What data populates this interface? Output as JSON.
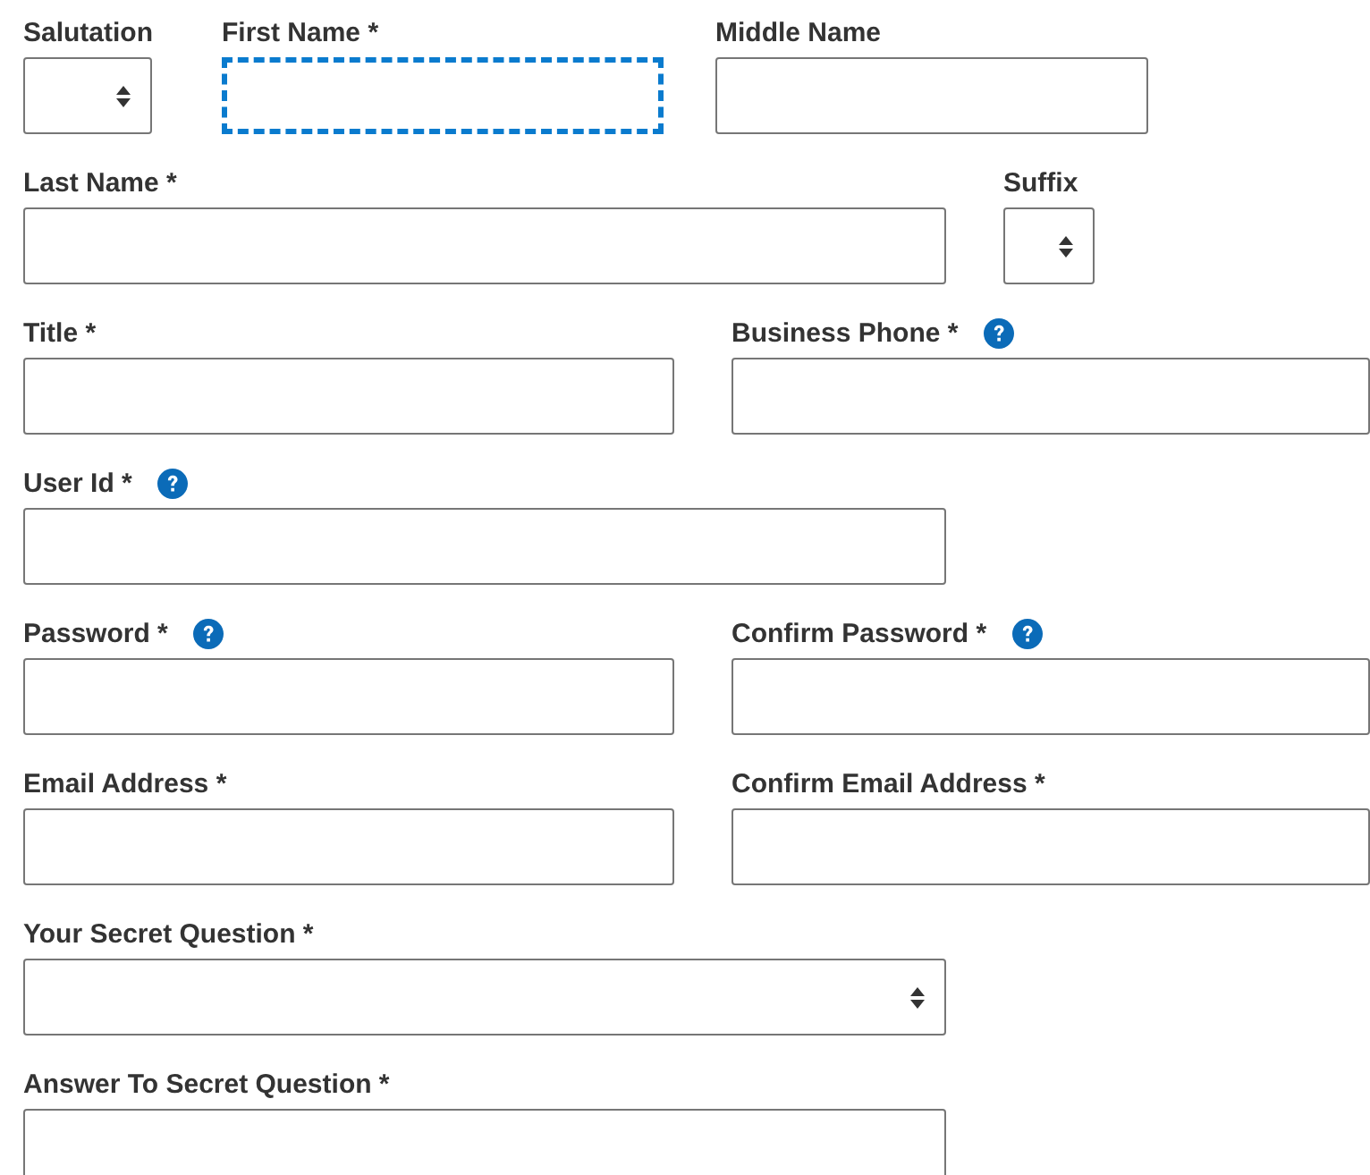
{
  "rows": [
    {
      "fields": [
        {
          "label": "Salutation",
          "kind": "select",
          "help": false,
          "focused": false
        },
        {
          "label": "First Name *",
          "kind": "text",
          "help": false,
          "focused": true
        },
        {
          "label": "Middle Name",
          "kind": "text",
          "help": false,
          "focused": false
        }
      ]
    },
    {
      "fields": [
        {
          "label": "Last Name *",
          "kind": "text",
          "help": false,
          "focused": false
        },
        {
          "label": "Suffix",
          "kind": "select",
          "help": false,
          "focused": false
        }
      ]
    },
    {
      "fields": [
        {
          "label": "Title *",
          "kind": "text",
          "help": false,
          "focused": false
        },
        {
          "label": "Business Phone *",
          "kind": "text",
          "help": true,
          "focused": false
        }
      ]
    },
    {
      "fields": [
        {
          "label": "User Id *",
          "kind": "text",
          "help": true,
          "focused": false
        }
      ]
    },
    {
      "fields": [
        {
          "label": "Password *",
          "kind": "text",
          "help": true,
          "focused": false
        },
        {
          "label": "Confirm Password *",
          "kind": "text",
          "help": true,
          "focused": false
        }
      ]
    },
    {
      "fields": [
        {
          "label": "Email Address *",
          "kind": "text",
          "help": false,
          "focused": false
        },
        {
          "label": "Confirm Email Address *",
          "kind": "text",
          "help": false,
          "focused": false
        }
      ]
    },
    {
      "fields": [
        {
          "label": "Your Secret Question *",
          "kind": "select",
          "help": false,
          "focused": false
        }
      ]
    },
    {
      "fields": [
        {
          "label": "Answer To Secret Question *",
          "kind": "text",
          "help": false,
          "focused": false
        }
      ]
    }
  ]
}
